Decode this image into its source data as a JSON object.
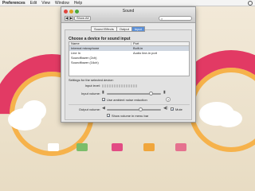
{
  "menubar": {
    "app": "Preferences",
    "items": [
      "Edit",
      "View",
      "Window",
      "Help"
    ]
  },
  "window": {
    "title": "Sound",
    "show_all": "Show All",
    "tabs": [
      "Sound Effects",
      "Output",
      "Input"
    ],
    "active_tab": "Input",
    "heading": "Choose a device for sound input",
    "columns": [
      "Name",
      "Port"
    ],
    "devices": [
      {
        "name": "Internal microphone",
        "port": "Built-in"
      },
      {
        "name": "Line In",
        "port": "Audio line-in port"
      },
      {
        "name": "Soundflower (2ch)",
        "port": ""
      },
      {
        "name": "Soundflower (16ch)",
        "port": ""
      }
    ],
    "settings_label": "Settings for the selected device:",
    "input_level_label": "Input level:",
    "input_volume_label": "Input volume:",
    "noise_reduction_label": "Use ambient noise reduction",
    "noise_reduction_checked": true,
    "output_volume_label": "Output volume:",
    "mute_label": "Mute",
    "mute_checked": true,
    "menu_bar_label": "Show volume in menu bar",
    "menu_bar_checked": true,
    "help_glyph": "?",
    "input_volume_level": 0.82,
    "output_volume_level": 0.62
  },
  "desktop": {
    "tile_colors": [
      "#ffffff",
      "#7bbd6a",
      "#e24c84",
      "#f0a63c",
      "#e5728f"
    ]
  },
  "colors": {
    "accent": "#5a8fd8",
    "rainbow_red": "#e23a64",
    "rainbow_orange": "#f6b24b"
  }
}
